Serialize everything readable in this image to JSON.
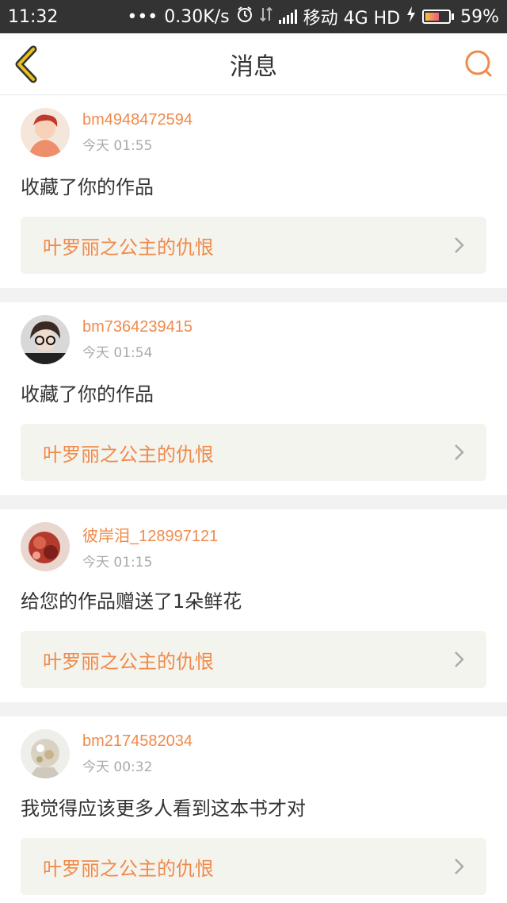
{
  "statusbar": {
    "time": "11:32",
    "speed": "0.30K/s",
    "carrier": "移动 4G HD",
    "battery": "59%",
    "battery_level": 0.59
  },
  "header": {
    "title": "消息",
    "back_icon": "chevron-left-icon",
    "search_icon": "search-icon"
  },
  "colors": {
    "accent": "#f08a4b",
    "back": "#e0b020"
  },
  "messages": [
    {
      "user": "bm4948472594",
      "time": "今天 01:55",
      "text": "收藏了你的作品",
      "work": "叶罗丽之公主的仇恨"
    },
    {
      "user": "bm7364239415",
      "time": "今天 01:54",
      "text": "收藏了你的作品",
      "work": "叶罗丽之公主的仇恨"
    },
    {
      "user": "彼岸泪_128997121",
      "time": "今天 01:15",
      "text": "给您的作品赠送了1朵鲜花",
      "work": "叶罗丽之公主的仇恨"
    },
    {
      "user": "bm2174582034",
      "time": "今天 00:32",
      "text": "我觉得应该更多人看到这本书才对",
      "work": "叶罗丽之公主的仇恨"
    }
  ]
}
